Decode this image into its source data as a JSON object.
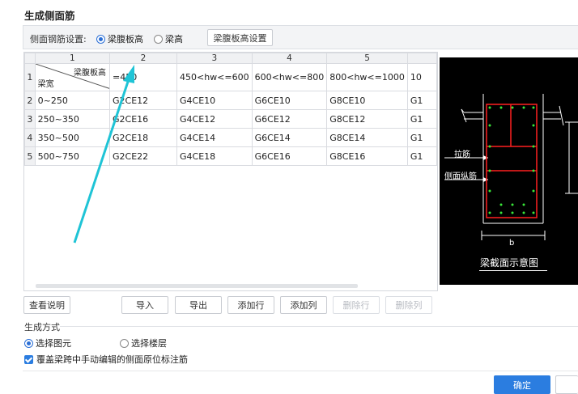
{
  "dialog": {
    "title": "生成侧面筋"
  },
  "settings": {
    "label": "侧面钢筋设置:",
    "radio_web_height": "梁腹板高",
    "radio_beam_height": "梁高",
    "selected": "梁腹板高",
    "settings_button": "梁腹板高设置"
  },
  "grid": {
    "col_headers": [
      "1",
      "2",
      "3",
      "4",
      "5"
    ],
    "corner_top": "梁腹板高",
    "corner_bottom": "梁宽",
    "row1": [
      "=450",
      "450<hw<=600",
      "600<hw<=800",
      "800<hw<=1000",
      "10"
    ],
    "rows": [
      {
        "num": "2",
        "cells": [
          "0~250",
          "G2CE12",
          "G4CE10",
          "G6CE10",
          "G8CE10",
          "G1"
        ]
      },
      {
        "num": "3",
        "cells": [
          "250~350",
          "G2CE16",
          "G4CE12",
          "G6CE12",
          "G8CE12",
          "G1"
        ]
      },
      {
        "num": "4",
        "cells": [
          "350~500",
          "G2CE18",
          "G4CE14",
          "G6CE14",
          "G8CE14",
          "G1"
        ]
      },
      {
        "num": "5",
        "cells": [
          "500~750",
          "G2CE22",
          "G4CE18",
          "G6CE16",
          "G8CE16",
          "G1"
        ]
      }
    ]
  },
  "preview": {
    "label_tie": "拉筋",
    "label_side": "侧面纵筋",
    "label_b": "b",
    "caption": "梁截面示意图"
  },
  "actions": {
    "help": "查看说明",
    "import": "导入",
    "export": "导出",
    "add_row": "添加行",
    "add_col": "添加列",
    "delete_row": "删除行",
    "delete_col": "删除列"
  },
  "generate": {
    "section_title": "生成方式",
    "option_element": "选择图元",
    "option_floor": "选择楼层",
    "selected": "选择图元",
    "overwrite_label": "覆盖梁跨中手动编辑的侧面原位标注筋",
    "overwrite_checked": true
  },
  "footer": {
    "ok": "确定"
  },
  "colors": {
    "accent": "#2b7de0",
    "arrow": "#1fc4d6",
    "rebar": "#ff2020",
    "rebar_dot": "#39e639"
  }
}
